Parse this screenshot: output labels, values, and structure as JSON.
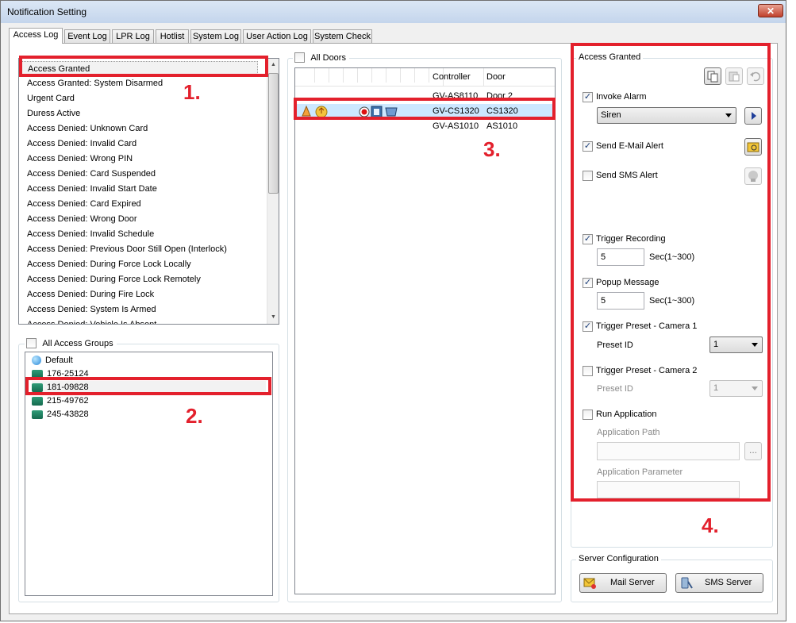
{
  "window": {
    "title": "Notification Setting",
    "close_glyph": "✕"
  },
  "tabs": [
    {
      "label": "Access Log",
      "active": true
    },
    {
      "label": "Event Log"
    },
    {
      "label": "LPR Log"
    },
    {
      "label": "Hotlist"
    },
    {
      "label": "System Log"
    },
    {
      "label": "User Action Log"
    },
    {
      "label": "System Check"
    }
  ],
  "events": {
    "items": [
      "Access Granted",
      "Access Granted: System Disarmed",
      "Urgent Card",
      "Duress Active",
      "Access Denied: Unknown Card",
      "Access Denied: Invalid Card",
      "Access Denied: Wrong PIN",
      "Access Denied: Card Suspended",
      "Access Denied: Invalid Start Date",
      "Access Denied: Card Expired",
      "Access Denied: Wrong Door",
      "Access Denied: Invalid Schedule",
      "Access Denied: Previous Door Still Open (Interlock)",
      "Access Denied: During Force Lock Locally",
      "Access Denied: During Force Lock Remotely",
      "Access Denied: During Fire Lock",
      "Access Denied: System Is Armed",
      "Access Denied: Vehicle Is Absent"
    ],
    "selected_index": 0
  },
  "access_groups": {
    "all_label": "All Access Groups",
    "items": [
      {
        "label": "Default",
        "icon": "globe-icon"
      },
      {
        "label": "176-25124",
        "icon": "group-icon"
      },
      {
        "label": "181-09828",
        "icon": "group-icon"
      },
      {
        "label": "215-49762",
        "icon": "group-icon"
      },
      {
        "label": "245-43828",
        "icon": "group-icon"
      }
    ],
    "selected_index": 2
  },
  "doors": {
    "all_label": "All Doors",
    "columns": {
      "controller": "Controller",
      "door": "Door"
    },
    "rows": [
      {
        "controller": "GV-AS8110",
        "door": "Door 2"
      },
      {
        "controller": "GV-CS1320",
        "door": "CS1320"
      },
      {
        "controller": "GV-AS1010",
        "door": "AS1010"
      }
    ],
    "selected_index": 1
  },
  "settings": {
    "group_title": "Access Granted",
    "invoke_alarm": {
      "label": "Invoke Alarm",
      "checked": true,
      "value": "Siren"
    },
    "send_email": {
      "label": "Send E-Mail Alert",
      "checked": true
    },
    "send_sms": {
      "label": "Send SMS Alert",
      "checked": false
    },
    "trigger_recording": {
      "label": "Trigger Recording",
      "checked": true,
      "value": "5",
      "unit": "Sec(1~300)"
    },
    "popup_message": {
      "label": "Popup Message",
      "checked": true,
      "value": "5",
      "unit": "Sec(1~300)"
    },
    "trigger_preset_1": {
      "label": "Trigger Preset - Camera 1",
      "checked": true,
      "preset_label": "Preset ID",
      "preset_value": "1"
    },
    "trigger_preset_2": {
      "label": "Trigger Preset - Camera 2",
      "checked": false,
      "preset_label": "Preset ID",
      "preset_value": "1"
    },
    "run_application": {
      "label": "Run Application",
      "checked": false,
      "path_label": "Application Path",
      "path_value": "",
      "browse_label": "...",
      "param_label": "Application Parameter",
      "param_value": ""
    }
  },
  "server_config": {
    "title": "Server Configuration",
    "mail_button": "Mail Server",
    "sms_button": "SMS Server"
  },
  "annotations": [
    "1.",
    "2.",
    "3.",
    "4."
  ],
  "colors": {
    "annotation": "#e3202c",
    "selection": "#cce8ff"
  }
}
